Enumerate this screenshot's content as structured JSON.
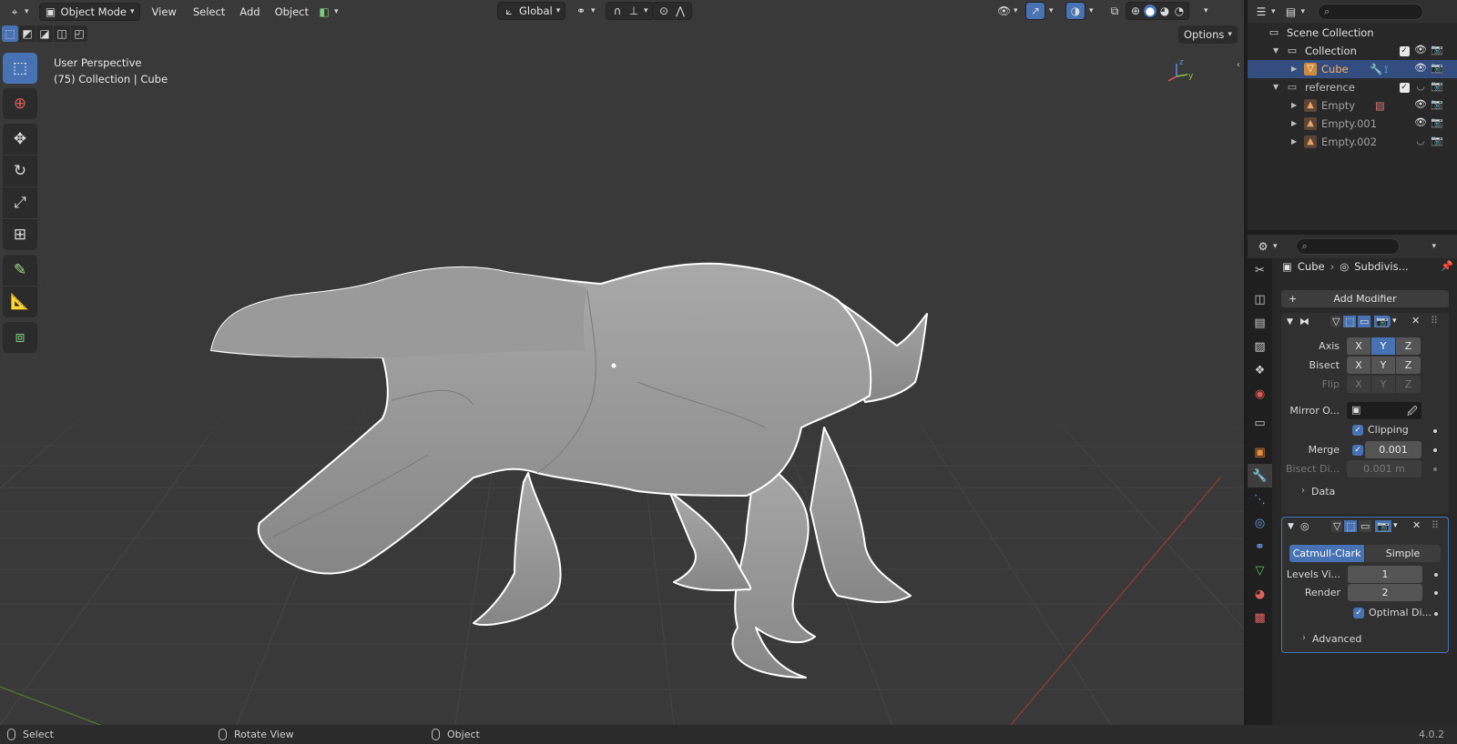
{
  "viewport": {
    "header": {
      "editor_type_icon": "axes-editor-icon",
      "mode": "Object Mode",
      "menus": [
        "View",
        "Select",
        "Add",
        "Object"
      ],
      "transform_orientation": "Global"
    },
    "info_line1": "User Perspective",
    "info_line2": "(75) Collection | Cube",
    "options_label": "Options",
    "gizmo": {
      "z": "z",
      "y": "y"
    },
    "tools": [
      "select-box-icon",
      "cursor-icon",
      "move-icon",
      "rotate-icon",
      "scale-icon",
      "transform-icon",
      "annotate-icon",
      "measure-icon",
      "add-cube-icon"
    ]
  },
  "outliner": {
    "rows": [
      {
        "label": "Scene Collection",
        "level": 0
      },
      {
        "label": "Collection",
        "level": 1
      },
      {
        "label": "Cube",
        "level": 2,
        "selected": true
      },
      {
        "label": "reference",
        "level": 1
      },
      {
        "label": "Empty",
        "level": 2
      },
      {
        "label": "Empty.001",
        "level": 2
      },
      {
        "label": "Empty.002",
        "level": 2
      }
    ]
  },
  "properties": {
    "breadcrumb_object": "Cube",
    "breadcrumb_modifier": "Subdivis...",
    "add_modifier": "Add Modifier",
    "mirror": {
      "axis_label": "Axis",
      "bisect_label": "Bisect",
      "flip_label": "Flip",
      "x": "X",
      "y": "Y",
      "z": "Z",
      "mirror_object_label": "Mirror O...",
      "clipping_label": "Clipping",
      "merge_label": "Merge",
      "merge_value": "0.001",
      "bisect_distance_label": "Bisect Di...",
      "bisect_distance_value": "0.001 m",
      "data_label": "Data"
    },
    "subdivision": {
      "catmull_clark": "Catmull-Clark",
      "simple": "Simple",
      "levels_viewport_label": "Levels Vi...",
      "levels_viewport_value": "1",
      "render_label": "Render",
      "render_value": "2",
      "optimal_label": "Optimal Di...",
      "advanced_label": "Advanced"
    }
  },
  "statusbar": {
    "select": "Select",
    "rotate": "Rotate View",
    "object": "Object",
    "version": "4.0.2"
  },
  "colors": {
    "accent": "#4772b3",
    "viewport_bg": "#393939",
    "panel_bg": "#282828"
  }
}
